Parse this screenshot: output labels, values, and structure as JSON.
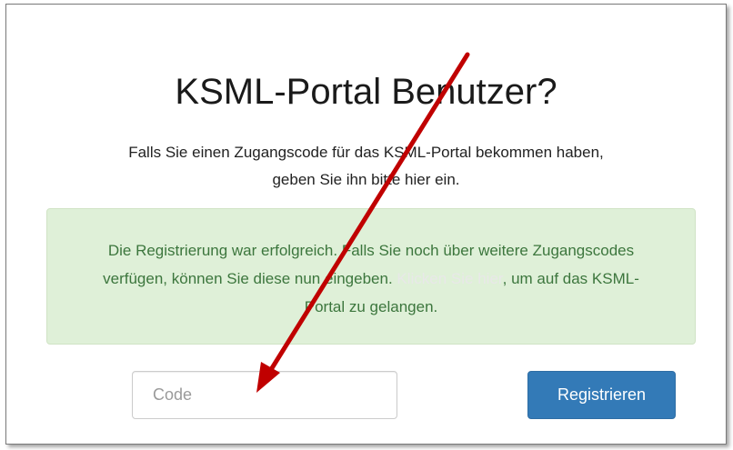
{
  "page": {
    "title": "KSML-Portal Benutzer?",
    "intro_line1": "Falls Sie einen Zugangscode für das KSML-Portal bekommen haben,",
    "intro_line2": "geben Sie ihn bitte hier ein."
  },
  "alert": {
    "text_part1": "Die Registrierung war erfolgreich. Falls Sie noch über weitere Zugangscodes verfügen, können Sie diese nun eingeben. ",
    "link_text": "Klicken Sie hier",
    "text_part2": ", um auf das KSML-Portal zu gelangen."
  },
  "form": {
    "code_placeholder": "Code",
    "code_value": "",
    "submit_label": "Registrieren"
  },
  "annotation": {
    "arrow_icon": "red-arrow-icon",
    "arrow_color": "#c00000"
  },
  "colors": {
    "alert_background": "#dff0d8",
    "alert_text": "#3c763d",
    "button_primary": "#337ab7"
  }
}
